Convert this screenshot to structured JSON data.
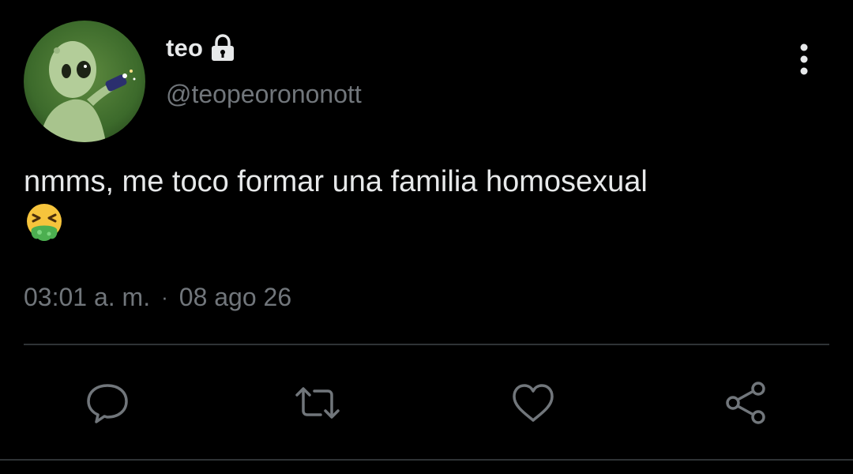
{
  "user": {
    "display_name": "teo",
    "handle": "@teopeorononott",
    "avatar_icon": "alien-avatar-icon",
    "protected_icon": "lock-icon"
  },
  "tweet": {
    "text": "nmms, me toco formar una familia homosexual",
    "emoji_icon": "vomiting-face-emoji",
    "time": "03:01 a. m.",
    "separator": "·",
    "date": "08 ago 26"
  },
  "actions": [
    {
      "name": "reply",
      "icon": "comment-icon"
    },
    {
      "name": "retweet",
      "icon": "retweet-icon"
    },
    {
      "name": "like",
      "icon": "heart-icon"
    },
    {
      "name": "share",
      "icon": "share-icon"
    }
  ],
  "colors": {
    "background": "#000000",
    "primary_text": "#e7e9ea",
    "secondary_text": "#71767b",
    "divider": "#2f3336"
  }
}
